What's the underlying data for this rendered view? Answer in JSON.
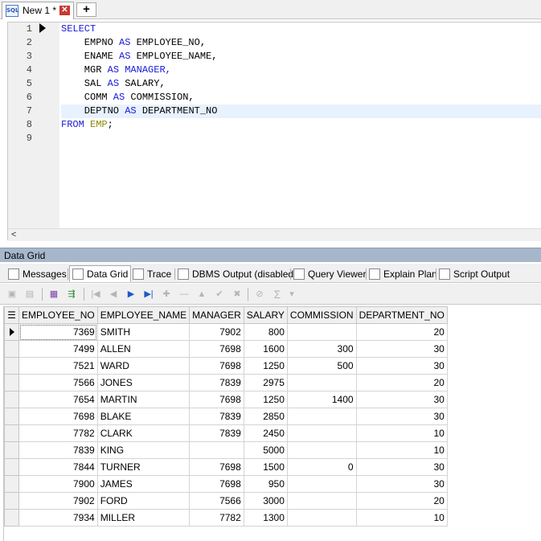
{
  "tabs": {
    "icon": "sql-file-icon",
    "icon_text": "SQL",
    "title": "New 1 *",
    "close_label": "✕",
    "new_tab_label": "+"
  },
  "editor": {
    "line_numbers": [
      "1",
      "2",
      "3",
      "4",
      "5",
      "6",
      "7",
      "8",
      "9"
    ],
    "current_line": 7,
    "code": {
      "l1_kw": "SELECT",
      "l2_a": "    EMPNO",
      "l2_kw": " AS ",
      "l2_b": "EMPLOYEE_NO,",
      "l3_a": "    ENAME",
      "l3_kw": " AS ",
      "l3_b": "EMPLOYEE_NAME,",
      "l4_a": "    MGR",
      "l4_kw": " AS ",
      "l4_b": "MANAGER,",
      "l5_a": "    SAL",
      "l5_kw": " AS ",
      "l5_b": "SALARY,",
      "l6_a": "    COMM",
      "l6_kw": " AS ",
      "l6_b": "COMMISSION,",
      "l7_a": "    DEPTNO",
      "l7_kw": " AS ",
      "l7_b": "DEPARTMENT_NO",
      "l8_kw": "FROM",
      "l8_tb": " EMP",
      "l8_p": ";"
    },
    "scroll_left_glyph": "<"
  },
  "results": {
    "pane_title": "Data Grid",
    "tabs": [
      {
        "label": "Messages",
        "icon": "messages-icon"
      },
      {
        "label": "Data Grid",
        "icon": "data-grid-icon"
      },
      {
        "label": "Trace",
        "icon": "trace-icon"
      },
      {
        "label": "DBMS Output (disabled)",
        "icon": "dbms-output-icon"
      },
      {
        "label": "Query Viewer",
        "icon": "query-viewer-icon"
      },
      {
        "label": "Explain Plan",
        "icon": "explain-plan-icon"
      },
      {
        "label": "Script Output",
        "icon": "script-output-icon"
      }
    ],
    "active_tab": "Data Grid",
    "toolbar_glyphs": {
      "first": "|◀",
      "prev": "◀",
      "next": "▶",
      "last": "▶|",
      "insert": "✚",
      "delete": "—",
      "up": "▲",
      "post": "✔",
      "cancel": "✖",
      "refresh": "⊘",
      "sum": "Σ",
      "dropdown": "▾"
    }
  },
  "grid": {
    "columns": [
      "EMPLOYEE_NO",
      "EMPLOYEE_NAME",
      "MANAGER",
      "SALARY",
      "COMMISSION",
      "DEPARTMENT_NO"
    ],
    "rows": [
      [
        "7369",
        "SMITH",
        "7902",
        "800",
        "",
        "20"
      ],
      [
        "7499",
        "ALLEN",
        "7698",
        "1600",
        "300",
        "30"
      ],
      [
        "7521",
        "WARD",
        "7698",
        "1250",
        "500",
        "30"
      ],
      [
        "7566",
        "JONES",
        "7839",
        "2975",
        "",
        "20"
      ],
      [
        "7654",
        "MARTIN",
        "7698",
        "1250",
        "1400",
        "30"
      ],
      [
        "7698",
        "BLAKE",
        "7839",
        "2850",
        "",
        "30"
      ],
      [
        "7782",
        "CLARK",
        "7839",
        "2450",
        "",
        "10"
      ],
      [
        "7839",
        "KING",
        "",
        "5000",
        "",
        "10"
      ],
      [
        "7844",
        "TURNER",
        "7698",
        "1500",
        "0",
        "30"
      ],
      [
        "7900",
        "JAMES",
        "7698",
        "950",
        "",
        "30"
      ],
      [
        "7902",
        "FORD",
        "7566",
        "3000",
        "",
        "20"
      ],
      [
        "7934",
        "MILLER",
        "7782",
        "1300",
        "",
        "10"
      ]
    ],
    "current_row": 0
  }
}
